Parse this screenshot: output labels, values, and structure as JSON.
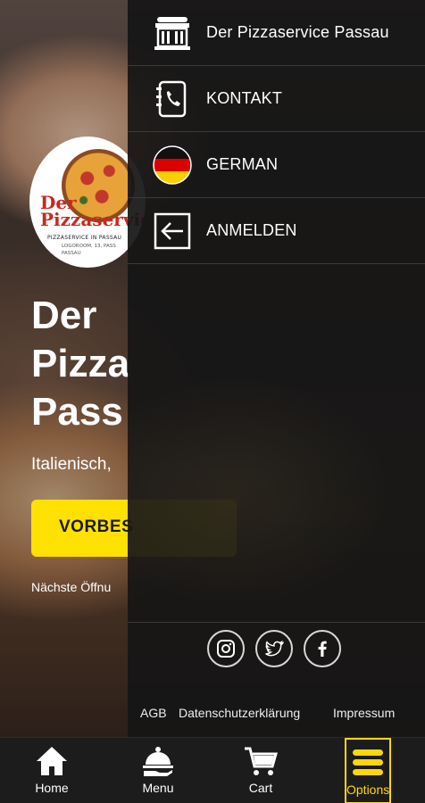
{
  "hero": {
    "logo": {
      "brand_line1": "Der",
      "brand_line2": "Pizzaservice",
      "tagline": "PIZZASERVICE IN PASSAU",
      "address_line1": "LOGOROOM, 13, PASS",
      "address_line2": "PASSAU"
    },
    "title_lines": [
      "Der",
      "Pizza",
      "Pass"
    ],
    "subtitle": "Italienisch,",
    "order_button": "VORBES",
    "next_opening": "Nächste Öffnu"
  },
  "drawer": {
    "items": [
      {
        "label": "Der Pizzaservice Passau",
        "icon": "store-icon"
      },
      {
        "label": "KONTAKT",
        "icon": "phone-book-icon"
      },
      {
        "label": "GERMAN",
        "icon": "german-flag-icon"
      },
      {
        "label": "ANMELDEN",
        "icon": "login-icon"
      }
    ],
    "social": [
      "instagram-icon",
      "twitter-icon",
      "facebook-icon"
    ],
    "legal_links": [
      "AGB",
      "Datenschutzerklärung",
      "Impressum"
    ]
  },
  "bottom_nav": {
    "items": [
      {
        "label": "Home",
        "icon": "home-icon"
      },
      {
        "label": "Menu",
        "icon": "cloche-icon"
      },
      {
        "label": "Cart",
        "icon": "cart-icon"
      },
      {
        "label": "Options",
        "icon": "hamburger-icon",
        "active": true
      }
    ]
  },
  "colors": {
    "accent": "#ffd60a",
    "drawer_bg": "#161616",
    "button_yellow": "#ffe100"
  }
}
